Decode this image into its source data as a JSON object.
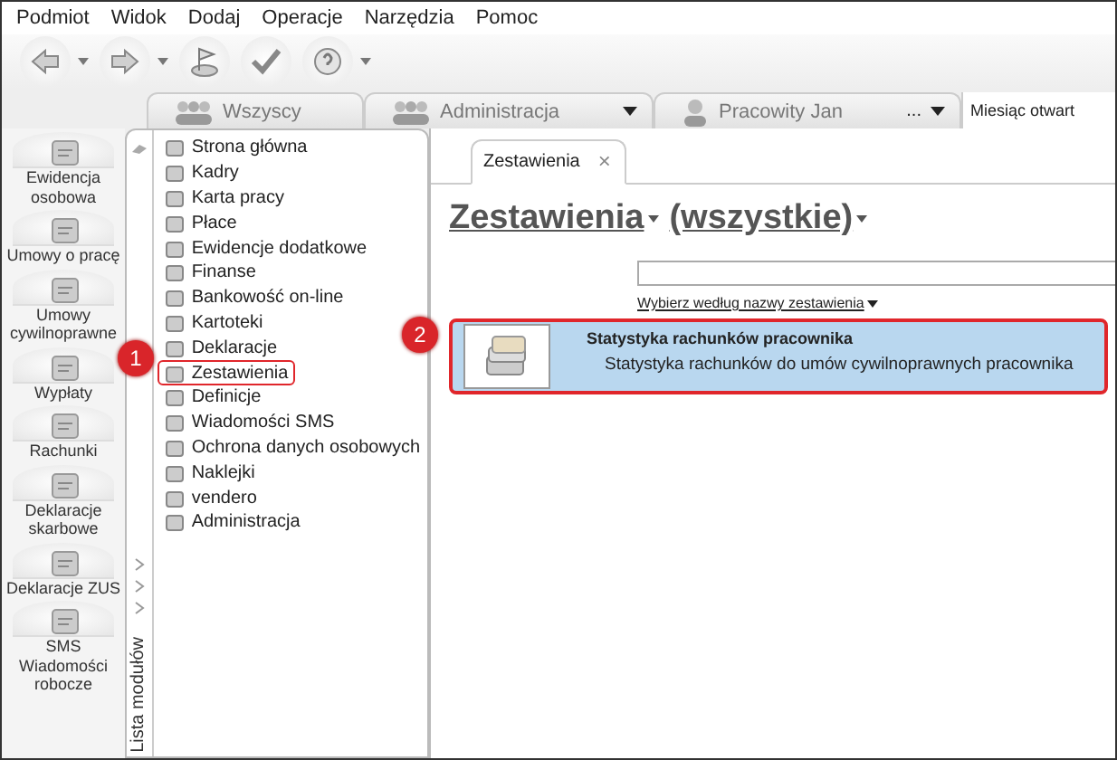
{
  "menu": [
    "Podmiot",
    "Widok",
    "Dodaj",
    "Operacje",
    "Narzędzia",
    "Pomoc"
  ],
  "toolbar": [
    {
      "kind": "back",
      "dropdown": true
    },
    {
      "kind": "forward",
      "dropdown": true
    },
    {
      "kind": "flag",
      "dropdown": false
    },
    {
      "kind": "check",
      "dropdown": false
    },
    {
      "kind": "help",
      "dropdown": true
    }
  ],
  "context_tabs": [
    {
      "label": "Wszyscy",
      "kind": "group",
      "dropdown": false
    },
    {
      "label": "Administracja",
      "kind": "group",
      "dropdown": true
    },
    {
      "label": "Pracowity Jan",
      "kind": "person",
      "dropdown": true,
      "more": "..."
    }
  ],
  "month_label": "Miesiąc otwart",
  "side_nav": [
    {
      "label": "Ewidencja osobowa"
    },
    {
      "label": "Umowy o pracę"
    },
    {
      "label": "Umowy cywilnoprawne"
    },
    {
      "label": "Wypłaty"
    },
    {
      "label": "Rachunki"
    },
    {
      "label": "Deklaracje skarbowe"
    },
    {
      "label": "Deklaracje ZUS"
    },
    {
      "label": "SMS Wiadomości robocze"
    }
  ],
  "module_panel": {
    "vertical_label": "Lista modułów",
    "items": [
      {
        "label": "Strona główna",
        "selected": false
      },
      {
        "label": "Kadry",
        "selected": false
      },
      {
        "label": "Karta pracy",
        "selected": false
      },
      {
        "label": "Płace",
        "selected": false
      },
      {
        "label": "Ewidencje dodatkowe",
        "selected": false
      },
      {
        "label": "Finanse",
        "selected": false
      },
      {
        "label": "Bankowość on-line",
        "selected": false
      },
      {
        "label": "Kartoteki",
        "selected": false
      },
      {
        "label": "Deklaracje",
        "selected": false
      },
      {
        "label": "Zestawienia",
        "selected": true
      },
      {
        "label": "Definicje",
        "selected": false
      },
      {
        "label": "Wiadomości SMS",
        "selected": false
      },
      {
        "label": "Ochrona danych osobowych",
        "selected": false
      },
      {
        "label": "Naklejki",
        "selected": false
      },
      {
        "label": "vendero",
        "selected": false
      },
      {
        "label": "Administracja",
        "selected": false
      }
    ]
  },
  "content": {
    "tab": {
      "label": "Zestawienia",
      "close": "×"
    },
    "heading": [
      "Zestawienia",
      "(wszystkie)"
    ],
    "filter_link": "Wybierz według nazwy zestawienia",
    "results": [
      {
        "title": "Statystyka rachunków pracownika",
        "description": "Statystyka rachunków do umów cywilnoprawnych pracownika",
        "selected": true
      }
    ]
  },
  "annotations": [
    {
      "number": "1"
    },
    {
      "number": "2"
    }
  ]
}
